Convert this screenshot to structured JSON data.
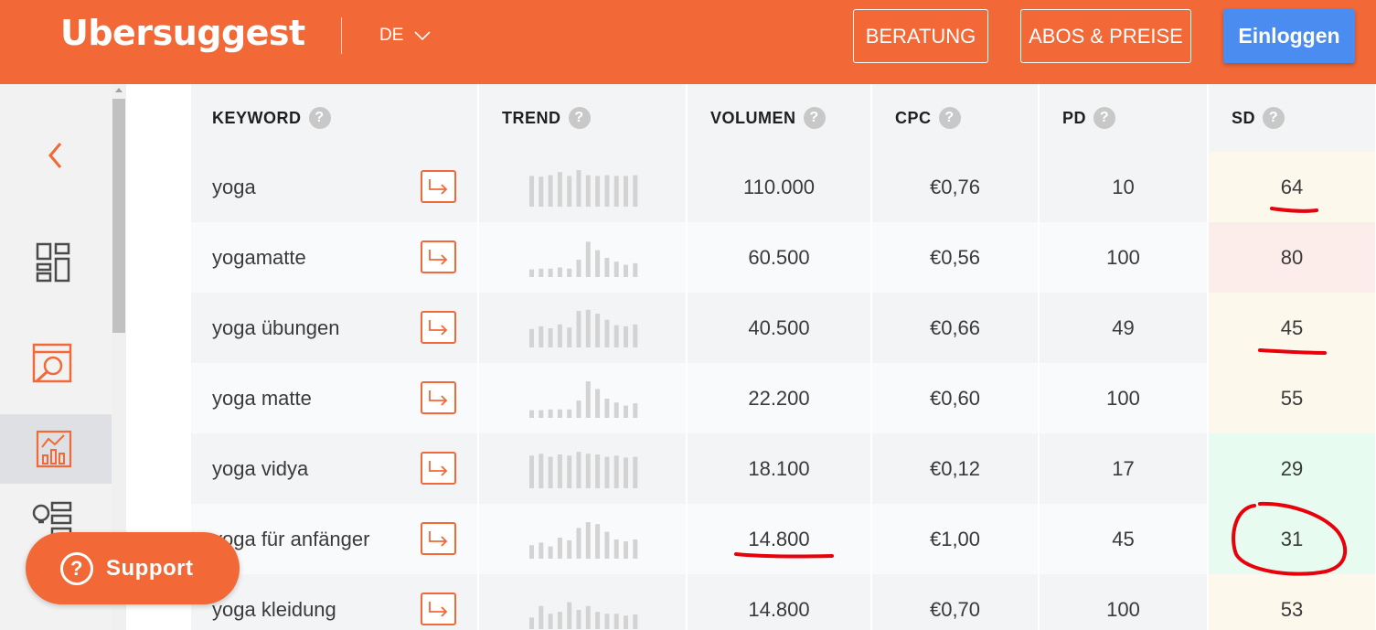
{
  "header": {
    "logo": "Ubersuggest",
    "language": "DE",
    "beratung_label": "BERATUNG",
    "abos_label": "ABOS & PREISE",
    "login_label": "Einloggen"
  },
  "columns": {
    "keyword": "KEYWORD",
    "trend": "TREND",
    "volume": "VOLUMEN",
    "cpc": "CPC",
    "pd": "PD",
    "sd": "SD",
    "help": "?"
  },
  "rows": [
    {
      "keyword": "yoga",
      "volume": "110.000",
      "cpc": "€0,76",
      "pd": "10",
      "sd": "64",
      "sd_level": "warn",
      "trend": [
        0.8,
        0.78,
        0.82,
        0.9,
        0.8,
        0.95,
        0.82,
        0.8,
        0.82,
        0.8,
        0.8,
        0.82
      ]
    },
    {
      "keyword": "yogamatte",
      "volume": "60.500",
      "cpc": "€0,56",
      "pd": "100",
      "sd": "80",
      "sd_level": "hard",
      "trend": [
        0.2,
        0.22,
        0.22,
        0.25,
        0.22,
        0.45,
        0.92,
        0.7,
        0.5,
        0.4,
        0.32,
        0.36
      ]
    },
    {
      "keyword": "yoga übungen",
      "volume": "40.500",
      "cpc": "€0,66",
      "pd": "49",
      "sd": "45",
      "sd_level": "warn",
      "trend": [
        0.48,
        0.55,
        0.5,
        0.6,
        0.52,
        0.95,
        0.98,
        0.88,
        0.72,
        0.58,
        0.55,
        0.6
      ]
    },
    {
      "keyword": "yoga matte",
      "volume": "22.200",
      "cpc": "€0,60",
      "pd": "100",
      "sd": "55",
      "sd_level": "warn",
      "trend": [
        0.2,
        0.2,
        0.22,
        0.22,
        0.22,
        0.45,
        0.95,
        0.75,
        0.5,
        0.4,
        0.32,
        0.38
      ]
    },
    {
      "keyword": "yoga vidya",
      "volume": "18.100",
      "cpc": "€0,12",
      "pd": "17",
      "sd": "29",
      "sd_level": "easy",
      "trend": [
        0.85,
        0.9,
        0.82,
        0.88,
        0.85,
        0.95,
        0.9,
        0.88,
        0.82,
        0.85,
        0.8,
        0.82
      ]
    },
    {
      "keyword": "yoga für anfänger",
      "volume": "14.800",
      "cpc": "€1,00",
      "pd": "45",
      "sd": "31",
      "sd_level": "easy",
      "trend": [
        0.35,
        0.42,
        0.32,
        0.55,
        0.48,
        0.8,
        0.95,
        0.9,
        0.7,
        0.5,
        0.45,
        0.5
      ]
    },
    {
      "keyword": "yoga kleidung",
      "volume": "14.800",
      "cpc": "€0,70",
      "pd": "100",
      "sd": "53",
      "sd_level": "warn",
      "trend": [
        0.3,
        0.6,
        0.4,
        0.45,
        0.7,
        0.5,
        0.6,
        0.45,
        0.4,
        0.4,
        0.35,
        0.38
      ]
    }
  ],
  "support": {
    "label": "Support",
    "icon": "?"
  },
  "sidebar": {
    "icons": [
      "back-chevron-icon",
      "dashboard-icon",
      "site-audit-icon",
      "keyword-overview-icon",
      "keyword-ideas-icon"
    ],
    "active": "keyword-overview-icon"
  },
  "colors": {
    "brand": "#f26837",
    "login": "#4a8cf0",
    "annotation": "#e8000b"
  }
}
